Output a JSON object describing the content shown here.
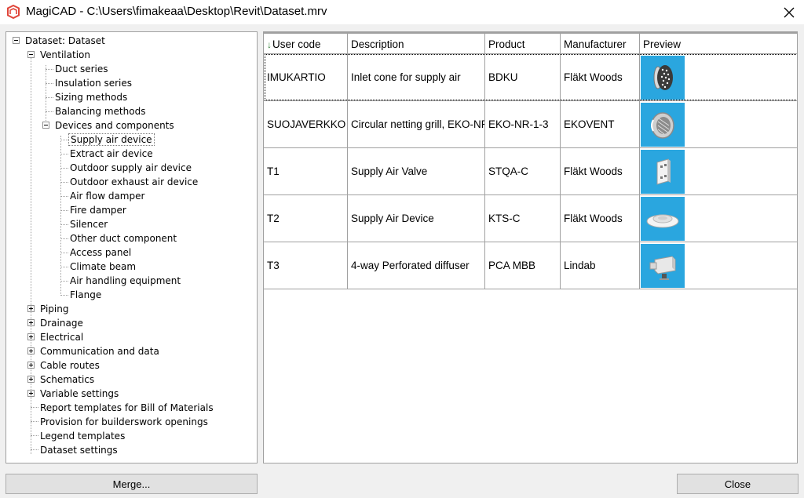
{
  "window": {
    "title": "MagiCAD - C:\\Users\\fimakeaa\\Desktop\\Revit\\Dataset.mrv"
  },
  "tree": {
    "root": "Dataset: Dataset",
    "ventilation": {
      "label": "Ventilation",
      "children": [
        "Duct series",
        "Insulation series",
        "Sizing methods",
        "Balancing methods"
      ],
      "devices": {
        "label": "Devices and components",
        "children": [
          "Supply air device",
          "Extract air device",
          "Outdoor supply air device",
          "Outdoor exhaust air device",
          "Air flow damper",
          "Fire damper",
          "Silencer",
          "Other duct component",
          "Access panel",
          "Climate beam",
          "Air handling equipment",
          "Flange"
        ],
        "selected": "Supply air device"
      }
    },
    "collapsed": [
      "Piping",
      "Drainage",
      "Electrical",
      "Communication and data",
      "Cable routes",
      "Schematics",
      "Variable settings"
    ],
    "leaves": [
      "Report templates for Bill of Materials",
      "Provision for builderswork openings",
      "Legend templates",
      "Dataset settings"
    ]
  },
  "grid": {
    "columns": [
      "User code",
      "Description",
      "Product",
      "Manufacturer",
      "Preview"
    ],
    "sort_column": "User code",
    "rows": [
      {
        "user_code": "IMUKARTIO",
        "description": "Inlet cone for supply air",
        "product": "BDKU",
        "manufacturer": "Fläkt Woods",
        "preview": "inlet-cone-image"
      },
      {
        "user_code": "SUOJAVERKKO",
        "description": "Circular netting grill, EKO-NR",
        "product": "EKO-NR-1-3",
        "manufacturer": "EKOVENT",
        "preview": "netting-grill-image"
      },
      {
        "user_code": "T1",
        "description": "Supply Air Valve",
        "product": "STQA-C",
        "manufacturer": "Fläkt Woods",
        "preview": "air-valve-image"
      },
      {
        "user_code": "T2",
        "description": "Supply Air Device",
        "product": "KTS-C",
        "manufacturer": "Fläkt Woods",
        "preview": "ceiling-device-image"
      },
      {
        "user_code": "T3",
        "description": "4-way Perforated diffuser",
        "product": "PCA MBB",
        "manufacturer": "Lindab",
        "preview": "perforated-diffuser-image"
      }
    ]
  },
  "buttons": {
    "merge": "Merge...",
    "close": "Close"
  },
  "colors": {
    "preview_bg": "#2aa6df",
    "sort_arrow": "#2e7d32",
    "app_icon": "#e0453a"
  }
}
